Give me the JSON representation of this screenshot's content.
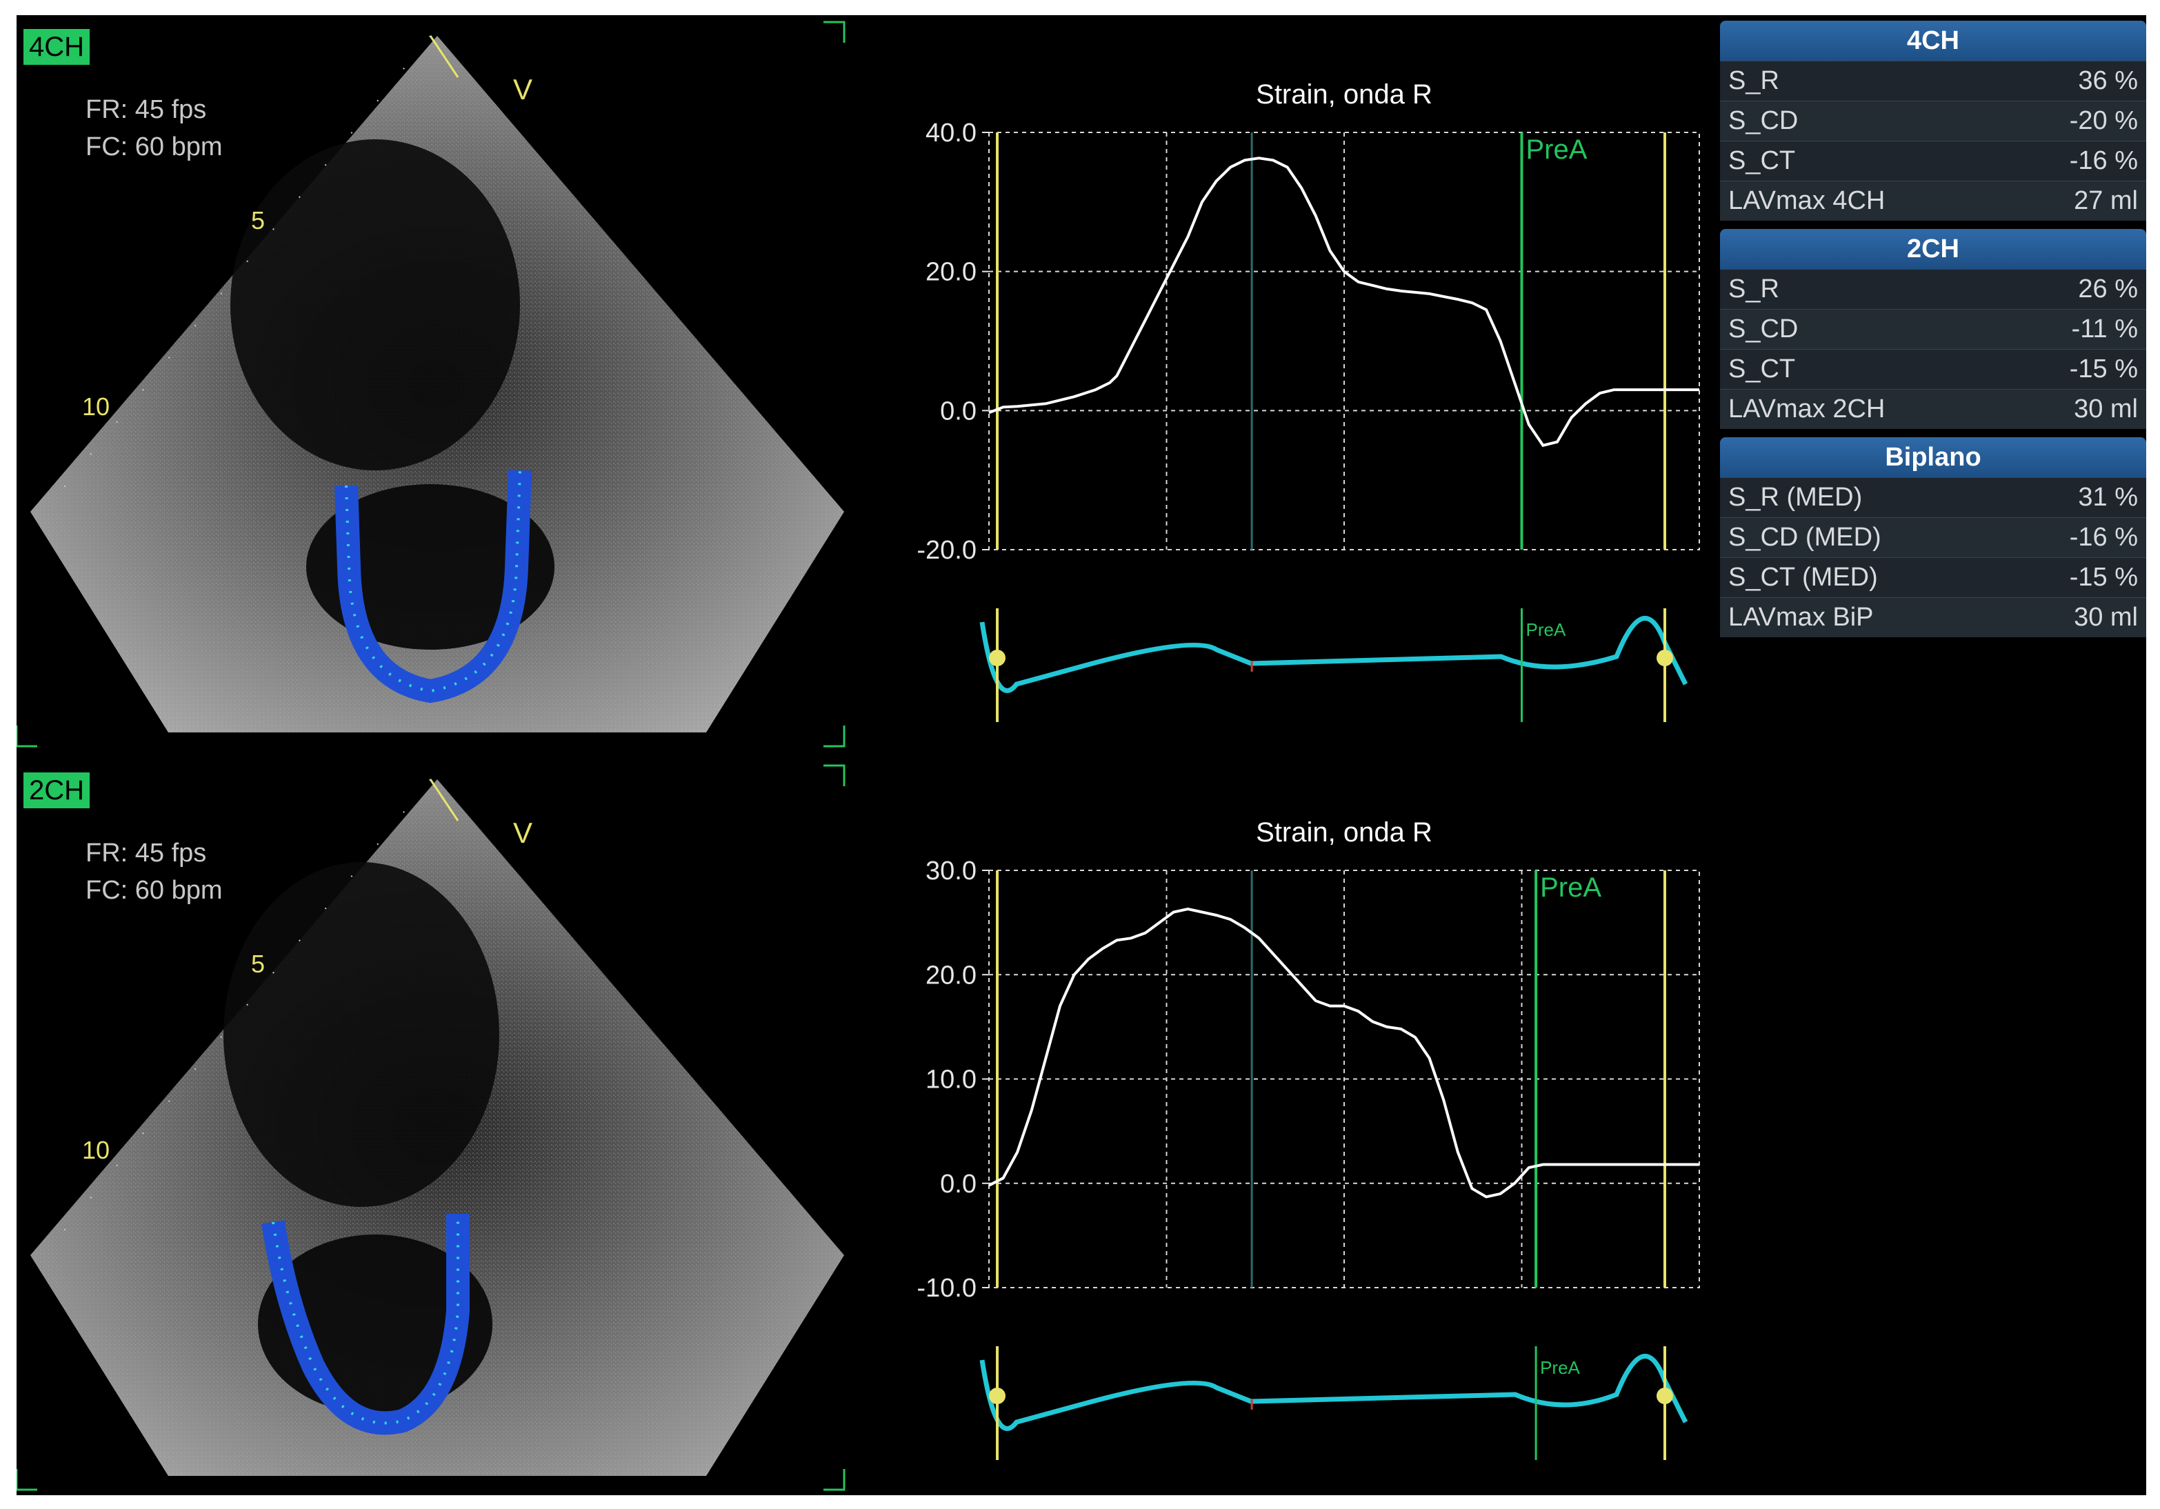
{
  "views": {
    "v4ch": {
      "label": "4CH",
      "fr": "FR: 45 fps",
      "fc": "FC: 60 bpm",
      "marker_v": "V",
      "depth_5": "5",
      "depth_10": "10"
    },
    "v2ch": {
      "label": "2CH",
      "fr": "FR: 45 fps",
      "fc": "FC: 60 bpm",
      "marker_v": "V",
      "depth_5": "5",
      "depth_10": "10"
    }
  },
  "colors": {
    "trace": "#ffffff",
    "grid": "#d9d9d9",
    "marker_yellow": "#e8e36a",
    "marker_green": "#22c55e",
    "ecg": "#22c7d6",
    "tracking": "#1f4fd6",
    "tracking_dots": "#33d6e8"
  },
  "chart_data": [
    {
      "type": "line",
      "title": "Strain, onda R",
      "yticks": [
        "40.0",
        "20.0",
        "0.0",
        "-20.0"
      ],
      "ylim": [
        -20,
        40
      ],
      "marker_label": "PreA",
      "series": [
        {
          "x": [
            0,
            2,
            4,
            8,
            12,
            15,
            17,
            18,
            19,
            20,
            22,
            24,
            26,
            28,
            30,
            32,
            34,
            36,
            38,
            40,
            42,
            44,
            46,
            48,
            50,
            52,
            54,
            56,
            58,
            60,
            62,
            64,
            66,
            68,
            70,
            72,
            74,
            76,
            78,
            80,
            82,
            84,
            86,
            88,
            90,
            92,
            94,
            96,
            98,
            100
          ],
          "values": [
            -0.3,
            0.5,
            0.6,
            1,
            2,
            3,
            4,
            5,
            7,
            9,
            13,
            17,
            21,
            25,
            30,
            33,
            35,
            36,
            36.3,
            36,
            35,
            32,
            28,
            23,
            20,
            18.5,
            18,
            17.5,
            17.2,
            17,
            16.8,
            16.4,
            16,
            15.5,
            14.5,
            10,
            4,
            -2,
            -5,
            -4.5,
            -1,
            1,
            2.5,
            3,
            3,
            3,
            3,
            3,
            3,
            3
          ]
        }
      ],
      "ecg_label": "PreA"
    },
    {
      "type": "line",
      "title": "Strain, onda R",
      "yticks": [
        "30.0",
        "20.0",
        "10.0",
        "0.0",
        "-10.0"
      ],
      "ylim": [
        -10,
        30
      ],
      "marker_label": "PreA",
      "series": [
        {
          "x": [
            0,
            2,
            4,
            6,
            8,
            10,
            12,
            14,
            16,
            18,
            20,
            22,
            24,
            26,
            28,
            30,
            32,
            34,
            36,
            38,
            40,
            42,
            44,
            46,
            48,
            50,
            52,
            54,
            56,
            58,
            60,
            62,
            64,
            66,
            68,
            70,
            72,
            74,
            76,
            78,
            80,
            82,
            84,
            86,
            88,
            90,
            92,
            94,
            96,
            98,
            100
          ],
          "values": [
            -0.2,
            0.5,
            3,
            7,
            12,
            17,
            20,
            21.5,
            22.5,
            23.3,
            23.5,
            24,
            25,
            26,
            26.3,
            26,
            25.7,
            25.3,
            24.5,
            23.5,
            22,
            20.5,
            19,
            17.5,
            17,
            17,
            16.5,
            15.5,
            15,
            14.8,
            14,
            12,
            8,
            3,
            -0.5,
            -1.3,
            -1,
            0,
            1.5,
            1.8,
            1.8,
            1.8,
            1.8,
            1.8,
            1.8,
            1.8,
            1.8,
            1.8,
            1.8,
            1.8,
            1.8
          ]
        }
      ],
      "ecg_label": "PreA"
    }
  ],
  "tables": {
    "t4ch": {
      "title": "4CH",
      "rows": [
        {
          "label": "S_R",
          "value": "36 %"
        },
        {
          "label": "S_CD",
          "value": "-20 %"
        },
        {
          "label": "S_CT",
          "value": "-16 %"
        },
        {
          "label": "LAVmax 4CH",
          "value": "27 ml"
        }
      ]
    },
    "t2ch": {
      "title": "2CH",
      "rows": [
        {
          "label": "S_R",
          "value": "26 %"
        },
        {
          "label": "S_CD",
          "value": "-11 %"
        },
        {
          "label": "S_CT",
          "value": "-15 %"
        },
        {
          "label": "LAVmax 2CH",
          "value": "30 ml"
        }
      ]
    },
    "tbip": {
      "title": "Biplano",
      "rows": [
        {
          "label": "S_R (MED)",
          "value": "31 %"
        },
        {
          "label": "S_CD (MED)",
          "value": "-16 %"
        },
        {
          "label": "S_CT (MED)",
          "value": "-15 %"
        },
        {
          "label": "LAVmax BiP",
          "value": "30 ml"
        }
      ]
    }
  }
}
